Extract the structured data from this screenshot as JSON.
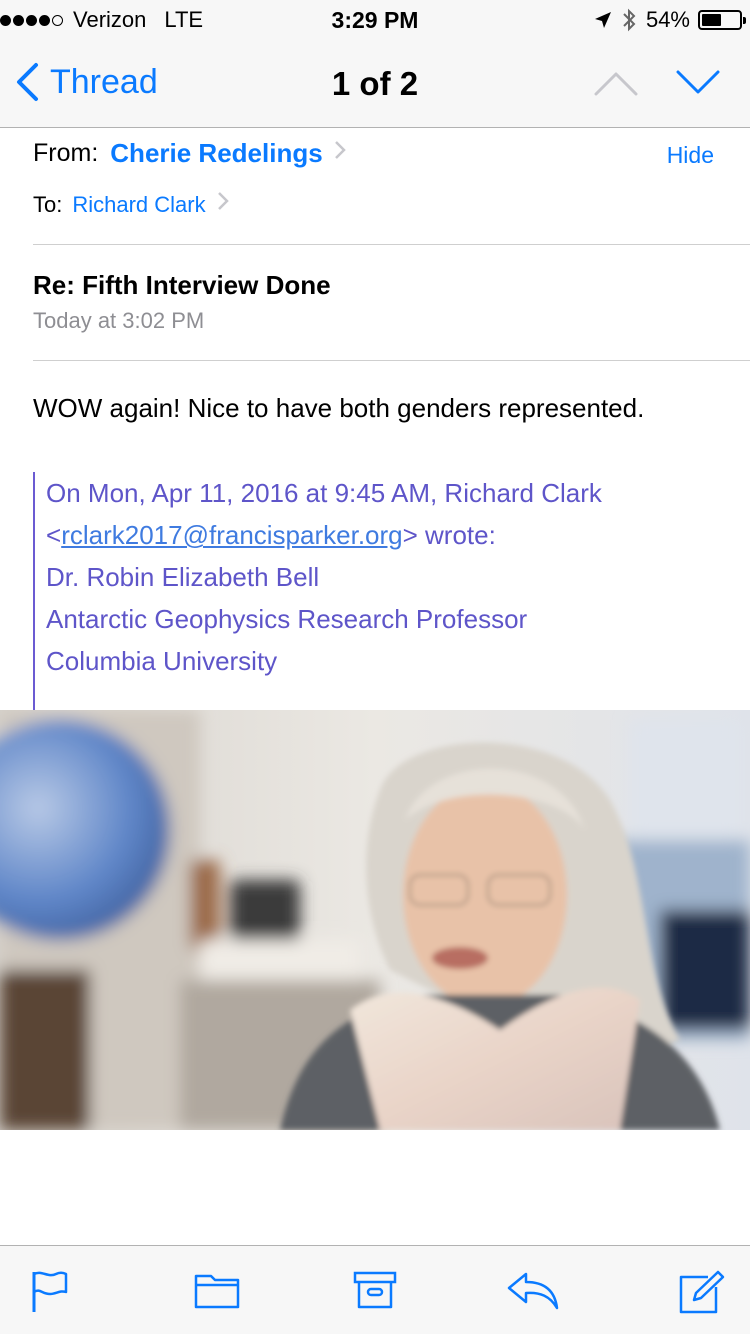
{
  "status_bar": {
    "carrier": "Verizon",
    "network": "LTE",
    "time": "3:29 PM",
    "battery_text": "54%",
    "battery_level": 0.54
  },
  "nav": {
    "back_label": "Thread",
    "title": "1 of 2"
  },
  "header": {
    "from_label": "From:",
    "from_name": "Cherie Redelings",
    "hide_label": "Hide",
    "to_label": "To:",
    "to_name": "Richard Clark",
    "subject": "Re: Fifth Interview Done",
    "date": "Today at 3:02 PM"
  },
  "body": {
    "text": "WOW again! Nice to have both genders represented."
  },
  "quote": {
    "line1": "On Mon, Apr 11, 2016 at 9:45 AM, Richard Clark",
    "line2_prefix": "<",
    "email": "rclark2017@francisparker.org",
    "line2_suffix": "> wrote:",
    "line3": "Dr. Robin Elizabeth Bell",
    "line4": "Antarctic Geophysics Research Professor",
    "line5": "Columbia University"
  },
  "colors": {
    "accent": "#0a7aff",
    "quote": "#5e55c9"
  },
  "toolbar": {
    "icons": [
      "flag-icon",
      "folder-icon",
      "archive-icon",
      "reply-icon",
      "compose-icon"
    ]
  }
}
